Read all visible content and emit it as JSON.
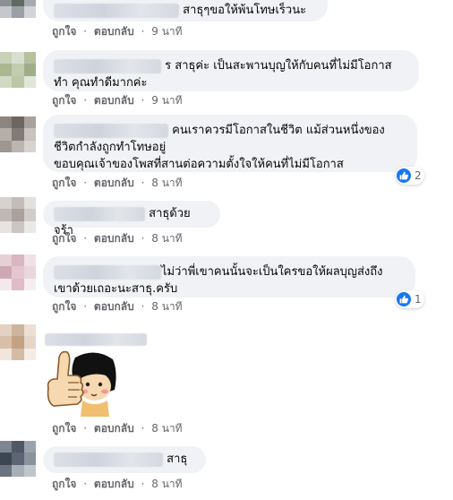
{
  "actions": {
    "like": "ถูกใจ",
    "reply": "ตอบกลับ",
    "separator": "·"
  },
  "comments": [
    {
      "text": "สาธุๆขอให้พ้นโทษเร็วนะ",
      "time": "9 นาที"
    },
    {
      "text_line1": "ร สาธุค่ะ เป็นสะพานบุญให้กับคนที่ไม่มีโอกาส",
      "text_line2": "ทำ คุณทำดีมากค่ะ",
      "time": "9 นาที"
    },
    {
      "text_line1": "คนเราควรมีโอกาสในชีวิต แม้ส่วนหนึ่งของ",
      "text_line2": "ชีวิตกำลังถูกทำโทษอยู่",
      "text_line3": "ขอบคุณเจ้าของโพสที่สานต่อความตั้งใจให้คนที่ไม่มีโอกาส",
      "time": "8 นาที",
      "reaction_count": "2"
    },
    {
      "text": "สาธุด้วยจร้า",
      "time": "8 นาที"
    },
    {
      "text_line1": "ไม่ว่าพี่เขาคนนั้นจะเป็นใครขอให้ผลบุญส่งถึง",
      "text_line2": "เขาด้วยเถอะนะสาธุ.ครับ",
      "time": "8 นาที",
      "reaction_count": "1"
    },
    {
      "sticker": "thumbs-up-girl-sticker",
      "time": "8 นาที"
    },
    {
      "text": "สาธุ",
      "time": "8 นาที"
    }
  ],
  "colors": {
    "bubble": "#f0f2f5",
    "meta": "#65676b",
    "like_blue": "#1877f2"
  }
}
